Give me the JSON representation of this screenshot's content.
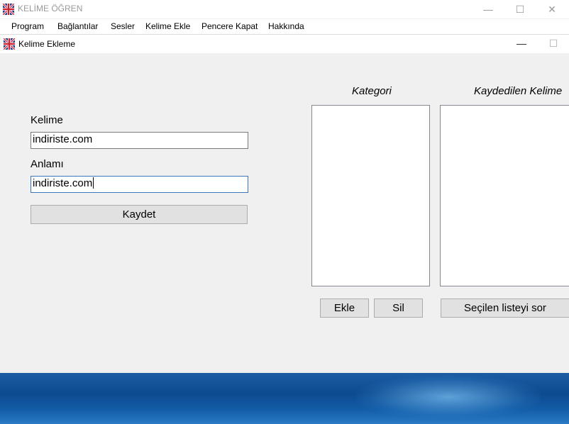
{
  "app": {
    "title": "KELİME ÖĞREN",
    "minimize_glyph": "—",
    "maximize_glyph": "☐",
    "close_glyph": "✕"
  },
  "menu": [
    "Program",
    "Bağlantılar",
    "Sesler",
    "Kelime Ekle",
    "Pencere Kapat",
    "Hakkında"
  ],
  "child_window": {
    "title": "Kelime Ekleme",
    "minimize_glyph": "—",
    "maximize_glyph": "☐"
  },
  "form": {
    "kelime_label": "Kelime",
    "kelime_value": "indiriste.com",
    "anlami_label": "Anlamı",
    "anlami_value": "indiriste.com",
    "save_label": "Kaydet"
  },
  "lists": {
    "kategori_header": "Kategori",
    "kaydedilen_header": "Kaydedilen Kelime",
    "kategori_items": [],
    "kaydedilen_items": [],
    "add_label": "Ekle",
    "delete_label": "Sil",
    "ask_label": "Seçilen listeyi sor"
  },
  "icons": {
    "app_icon": "uk-flag-icon"
  },
  "colors": {
    "focus_border": "#3a76b8",
    "window_bg": "#f0f0f0"
  }
}
